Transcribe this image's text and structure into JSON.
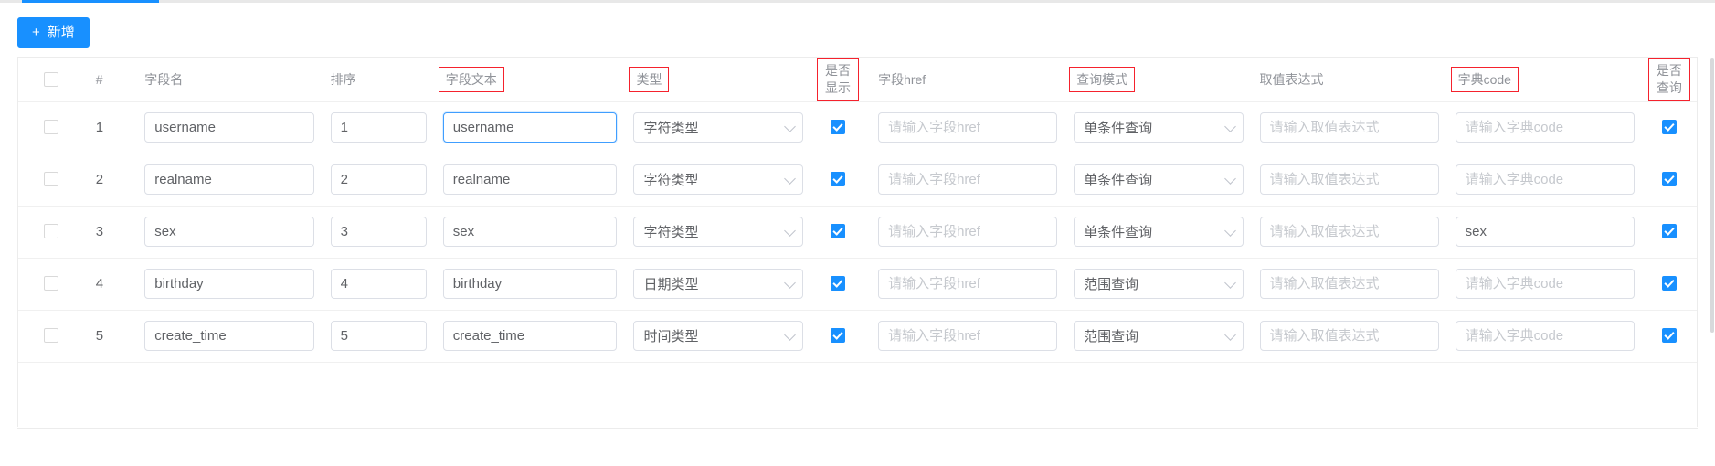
{
  "tab": {
    "active_indicator": true,
    "accent_color": "#1890ff"
  },
  "toolbar": {
    "add_button": {
      "icon": "plus-icon",
      "plus": "+",
      "label": "新增"
    }
  },
  "annotation": {
    "box_color": "#f5222d"
  },
  "table": {
    "columns": [
      {
        "key": "select",
        "label": "",
        "boxed": false,
        "align": "center"
      },
      {
        "key": "index",
        "label": "#",
        "boxed": false,
        "align": "left"
      },
      {
        "key": "field_name",
        "label": "字段名",
        "boxed": false,
        "align": "left"
      },
      {
        "key": "order",
        "label": "排序",
        "boxed": false,
        "align": "left"
      },
      {
        "key": "field_text",
        "label": "字段文本",
        "boxed": true,
        "align": "left"
      },
      {
        "key": "type",
        "label": "类型",
        "boxed": true,
        "align": "left"
      },
      {
        "key": "show",
        "label": "是否显示",
        "boxed": true,
        "align": "center"
      },
      {
        "key": "field_href",
        "label": "字段href",
        "boxed": false,
        "align": "left"
      },
      {
        "key": "query_mode",
        "label": "查询模式",
        "boxed": true,
        "align": "left"
      },
      {
        "key": "value_expr",
        "label": "取值表达式",
        "boxed": false,
        "align": "left"
      },
      {
        "key": "dict_code",
        "label": "字典code",
        "boxed": true,
        "align": "left"
      },
      {
        "key": "queryable",
        "label": "是否查询",
        "boxed": true,
        "align": "center"
      }
    ],
    "header_checkbox": {
      "checked": false
    },
    "placeholders": {
      "field_href": "请输入字段href",
      "value_expr": "请输入取值表达式",
      "dict_code": "请输入字典code"
    },
    "rows": [
      {
        "selected": false,
        "index": "1",
        "field_name": "username",
        "order": "1",
        "field_text": "username",
        "field_text_focused": true,
        "type": "字符类型",
        "show": true,
        "field_href": "",
        "query_mode": "单条件查询",
        "value_expr": "",
        "dict_code": "",
        "queryable": true
      },
      {
        "selected": false,
        "index": "2",
        "field_name": "realname",
        "order": "2",
        "field_text": "realname",
        "field_text_focused": false,
        "type": "字符类型",
        "show": true,
        "field_href": "",
        "query_mode": "单条件查询",
        "value_expr": "",
        "dict_code": "",
        "queryable": true
      },
      {
        "selected": false,
        "index": "3",
        "field_name": "sex",
        "order": "3",
        "field_text": "sex",
        "field_text_focused": false,
        "type": "字符类型",
        "show": true,
        "field_href": "",
        "query_mode": "单条件查询",
        "value_expr": "",
        "dict_code": "sex",
        "queryable": true
      },
      {
        "selected": false,
        "index": "4",
        "field_name": "birthday",
        "order": "4",
        "field_text": "birthday",
        "field_text_focused": false,
        "type": "日期类型",
        "show": true,
        "field_href": "",
        "query_mode": "范围查询",
        "value_expr": "",
        "dict_code": "",
        "queryable": true
      },
      {
        "selected": false,
        "index": "5",
        "field_name": "create_time",
        "order": "5",
        "field_text": "create_time",
        "field_text_focused": false,
        "type": "时间类型",
        "show": true,
        "field_href": "",
        "query_mode": "范围查询",
        "value_expr": "",
        "dict_code": "",
        "queryable": true
      }
    ]
  }
}
